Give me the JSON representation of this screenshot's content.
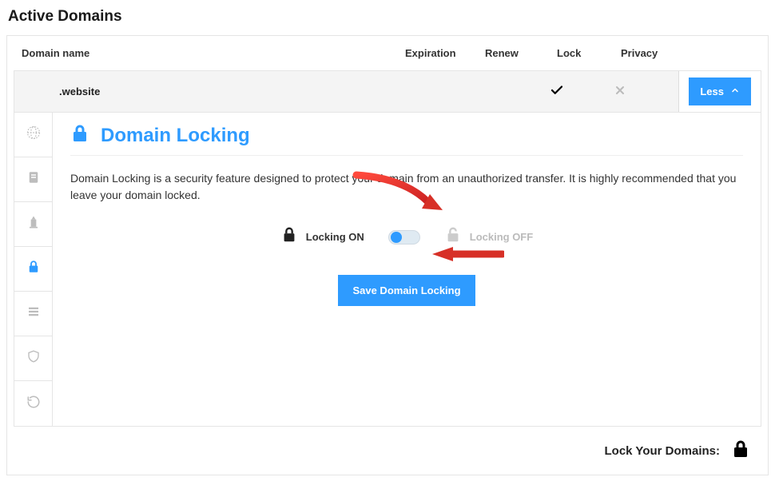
{
  "page": {
    "title": "Active Domains"
  },
  "columns": {
    "name": "Domain name",
    "expiration": "Expiration",
    "renew": "Renew",
    "lock": "Lock",
    "privacy": "Privacy"
  },
  "domain_row": {
    "name": ".website",
    "expiration": "",
    "renew": "",
    "lock_icon": "check",
    "privacy_icon": "x",
    "toggle_label": "Less"
  },
  "sidebar": {
    "items": [
      {
        "name": "globe-icon",
        "active": false
      },
      {
        "name": "card-icon",
        "active": false
      },
      {
        "name": "tower-icon",
        "active": false
      },
      {
        "name": "lock-icon",
        "active": true
      },
      {
        "name": "list-icon",
        "active": false
      },
      {
        "name": "shield-icon",
        "active": false
      },
      {
        "name": "refresh-icon",
        "active": false
      }
    ]
  },
  "section": {
    "title": "Domain Locking",
    "description": "Domain Locking is a security feature designed to protect your domain from an unauthorized transfer. It is highly recommended that you leave your domain locked.",
    "locking_on_label": "Locking ON",
    "locking_off_label": "Locking OFF",
    "save_button": "Save Domain Locking"
  },
  "footer": {
    "text": "Lock Your Domains:"
  }
}
